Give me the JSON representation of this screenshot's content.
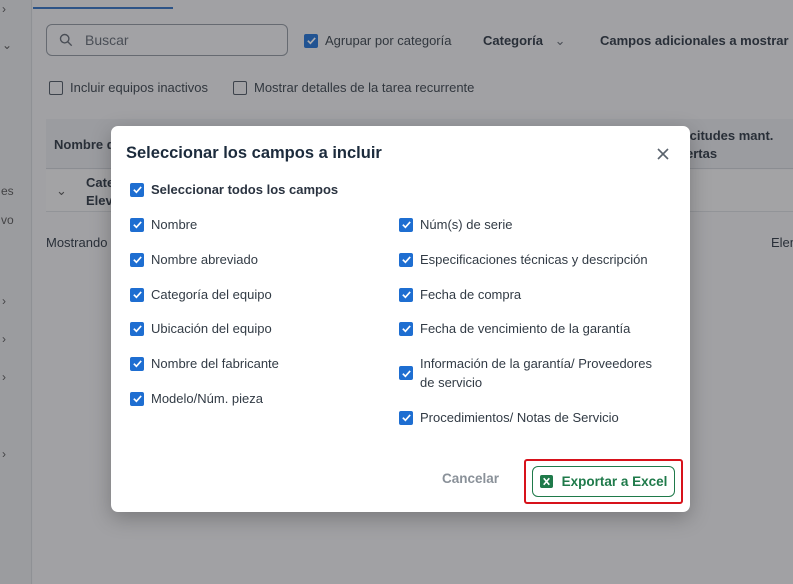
{
  "background": {
    "left_rail_fragments": [
      "es",
      "vo"
    ],
    "search_placeholder": "Buscar",
    "group_by_category_label": "Agrupar por categoría",
    "category_dropdown_label": "Categoría",
    "additional_fields_label": "Campos adicionales a mostrar",
    "include_inactive_label": "Incluir equipos inactivos",
    "show_recurring_details_label": "Mostrar detalles de la tarea recurrente",
    "table_col_name_fragment": "Nombre d",
    "table_col_requests_line1": "icitudes mant.",
    "table_col_requests_line2": "ertas",
    "row_fragment_line1": "Cate",
    "row_fragment_line2": "Elev",
    "showing_fragment": "Mostrando",
    "elements_fragment": "Elem"
  },
  "modal": {
    "title": "Seleccionar los campos a incluir",
    "select_all_label": "Seleccionar todos los campos",
    "fields_left": [
      "Nombre",
      "Nombre abreviado",
      "Categoría del equipo",
      "Ubicación del equipo",
      "Nombre del fabricante",
      "Modelo/Núm. pieza"
    ],
    "fields_right": [
      "Núm(s) de serie",
      "Especificaciones técnicas y descripción",
      "Fecha de compra",
      "Fecha de vencimiento de la garantía",
      "Información de la garantía/ Proveedores de servicio",
      "Procedimientos/ Notas de Servicio"
    ],
    "cancel_label": "Cancelar",
    "export_label": "Exportar a Excel"
  },
  "colors": {
    "accent_blue": "#1e6ed1",
    "export_green": "#1f7a4a",
    "highlight_red": "#d7121b"
  }
}
